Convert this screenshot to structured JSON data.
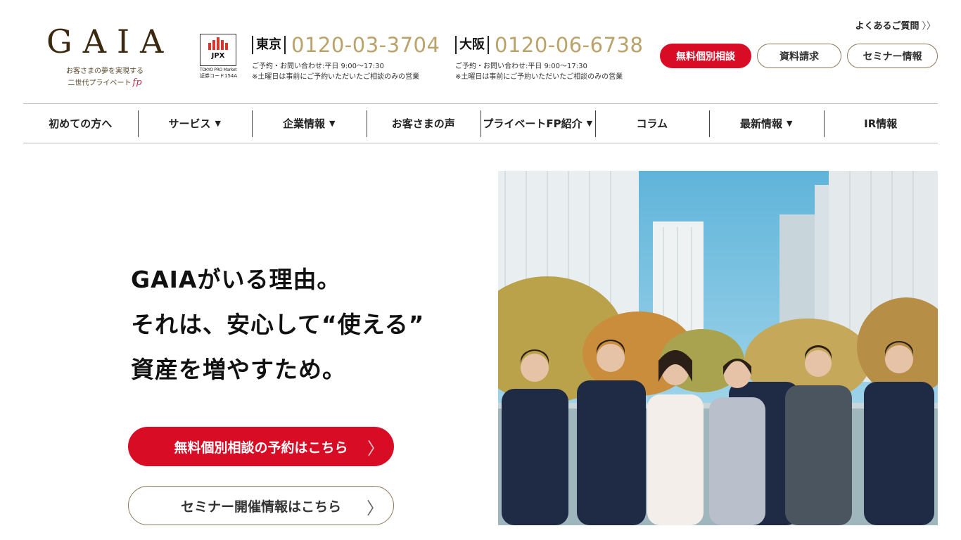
{
  "header": {
    "logo": {
      "wordmark": "GAIA",
      "tagline1": "お客さまの夢を実現する",
      "tagline2": "二世代プライベート",
      "tagline_fp": "fp"
    },
    "jpx": {
      "name": "JPX",
      "market": "TOKYO PRO Market",
      "code": "証券コード154A"
    },
    "phones": [
      {
        "city": "東京",
        "number": "0120-03-3704",
        "hours": "ご予約・お問い合わせ:平日 9:00〜17:30",
        "note": "※土曜日は事前にご予約いただいたご相談のみの営業"
      },
      {
        "city": "大阪",
        "number": "0120-06-6738",
        "hours": "ご予約・お問い合わせ:平日 9:00〜17:30",
        "note": "※土曜日は事前にご予約いただいたご相談のみの営業"
      }
    ],
    "faq_link": "よくあるご質問",
    "buttons": {
      "consult": "無料個別相談",
      "docs": "資料請求",
      "seminar": "セミナー情報"
    }
  },
  "nav": [
    {
      "label": "初めての方へ",
      "dropdown": false
    },
    {
      "label": "サービス",
      "dropdown": true
    },
    {
      "label": "企業情報",
      "dropdown": true
    },
    {
      "label": "お客さまの声",
      "dropdown": false
    },
    {
      "label": "プライベートFP紹介",
      "dropdown": true
    },
    {
      "label": "コラム",
      "dropdown": false
    },
    {
      "label": "最新情報",
      "dropdown": true
    },
    {
      "label": "IR情報",
      "dropdown": false
    }
  ],
  "hero": {
    "lines": [
      "GAIAがいる理由。",
      "それは、安心して“使える”",
      "資産を増やすため。"
    ],
    "cta_primary": "無料個別相談の予約はこちら",
    "cta_secondary": "セミナー開催情報はこちら"
  },
  "colors": {
    "brand_red": "#d80c24",
    "gold": "#b9a36a",
    "logo_brown": "#3b2a10"
  },
  "icons": {
    "caret": "caret-down-icon",
    "cta_arrow": "chevron-right-icon",
    "faq": "double-chevron-right-icon"
  }
}
